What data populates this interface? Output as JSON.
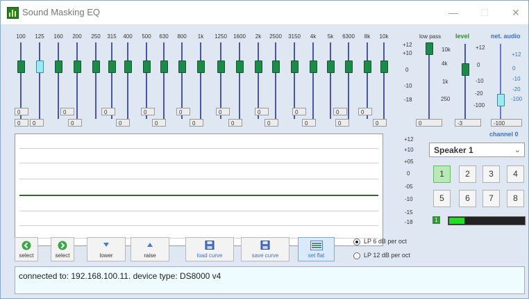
{
  "window": {
    "title": "Sound Masking EQ",
    "minimize": "—",
    "maximize": "☐",
    "close": "✕"
  },
  "eq": {
    "bands": [
      "100",
      "125",
      "160",
      "200",
      "250",
      "315",
      "400",
      "500",
      "630",
      "800",
      "1k",
      "1250",
      "1600",
      "2k",
      "2500",
      "3150",
      "4k",
      "5k",
      "6300",
      "8k",
      "10k"
    ],
    "selected_band": "125",
    "upper_values": [
      "0",
      "0",
      "0",
      "0",
      "0",
      "0",
      "0",
      "0",
      "0",
      "0",
      "0"
    ],
    "lower_values": [
      "0",
      "0",
      "0",
      "0",
      "0",
      "0",
      "0",
      "0",
      "0",
      "0",
      "0"
    ],
    "scale": [
      "+12",
      "+10",
      "0",
      "-10",
      "-18"
    ]
  },
  "low_pass": {
    "header": "low pass",
    "scale": [
      "10k",
      "4k",
      "1k",
      "250"
    ],
    "value": "0"
  },
  "level": {
    "header": "level",
    "scale": [
      "+12",
      "0",
      "-10",
      "-20",
      "-100"
    ],
    "value": "-3"
  },
  "net_audio": {
    "header": "net. audio",
    "scale": [
      "+12",
      "0",
      "-10",
      "-20",
      "-100"
    ],
    "value": "-100"
  },
  "channel": {
    "header": "channel 0",
    "speaker": "Speaker 1",
    "buttons": [
      "1",
      "2",
      "3",
      "4",
      "5",
      "6",
      "7",
      "8"
    ],
    "active": "1",
    "led_label": "1",
    "meter_level_percent": 20
  },
  "graph": {
    "scale": [
      "+12",
      "+10",
      "+05",
      "0",
      "-05",
      "-10",
      "-15",
      "-18"
    ]
  },
  "toolbar": {
    "select_prev": "select",
    "select_next": "select",
    "lower": "lower",
    "raise": "raise",
    "load_curve": "load curve",
    "save_curve": "save curve",
    "set_flat": "set flat"
  },
  "filter_options": {
    "lp6": "LP 6 dB per oct",
    "lp12": "LP 12 dB per oct",
    "selected": "lp6"
  },
  "status": {
    "text": "connected to: 192.168.100.11.   device type: DS8000 v4"
  }
}
